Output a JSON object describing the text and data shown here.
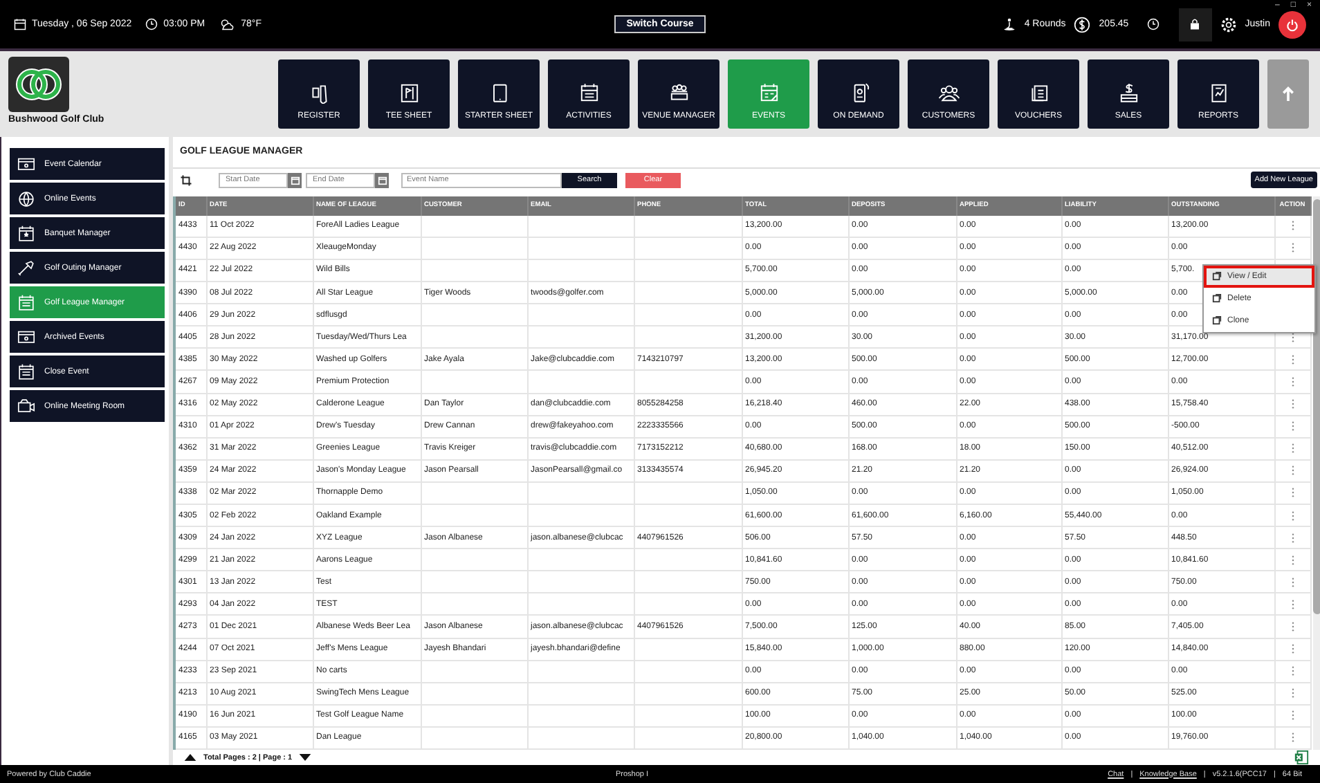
{
  "window_controls": [
    "–",
    "□",
    "×"
  ],
  "top_bar": {
    "date": "Tuesday , 06 Sep 2022",
    "time": "03:00 PM",
    "weather": "78°F",
    "switch_course": "Switch Course",
    "rounds": "4 Rounds",
    "balance": "205.45",
    "user": "Justin"
  },
  "club": {
    "name": "Bushwood Golf Club"
  },
  "nav": [
    {
      "label": "REGISTER",
      "selected": false
    },
    {
      "label": "TEE SHEET",
      "selected": false
    },
    {
      "label": "STARTER SHEET",
      "selected": false
    },
    {
      "label": "ACTIVITIES",
      "selected": false
    },
    {
      "label": "VENUE MANAGER",
      "selected": false
    },
    {
      "label": "EVENTS",
      "selected": true
    },
    {
      "label": "ON DEMAND",
      "selected": false
    },
    {
      "label": "CUSTOMERS",
      "selected": false
    },
    {
      "label": "VOUCHERS",
      "selected": false
    },
    {
      "label": "SALES",
      "selected": false
    },
    {
      "label": "REPORTS",
      "selected": false
    }
  ],
  "sidebar": [
    {
      "label": "Event Calendar",
      "selected": false
    },
    {
      "label": "Online Events",
      "selected": false
    },
    {
      "label": "Banquet Manager",
      "selected": false
    },
    {
      "label": "Golf Outing Manager",
      "selected": false
    },
    {
      "label": "Golf League Manager",
      "selected": true
    },
    {
      "label": "Archived Events",
      "selected": false
    },
    {
      "label": "Close Event",
      "selected": false
    },
    {
      "label": "Online Meeting Room",
      "selected": false
    }
  ],
  "page_title": "GOLF LEAGUE MANAGER",
  "filters": {
    "start_date": {
      "placeholder": "Start Date"
    },
    "end_date": {
      "placeholder": "End Date"
    },
    "event_name": {
      "placeholder": "Event Name"
    },
    "search": "Search",
    "clear": "Clear",
    "add": "Add New League"
  },
  "table": {
    "columns": [
      "ID",
      "DATE",
      "NAME OF LEAGUE",
      "CUSTOMER",
      "EMAIL",
      "PHONE",
      "TOTAL",
      "DEPOSITS",
      "APPLIED",
      "LIABILITY",
      "OUTSTANDING",
      "ACTION"
    ],
    "rows": [
      [
        "4433",
        "11 Oct 2022",
        "ForeAll Ladies League",
        null,
        null,
        null,
        "13,200.00",
        "0.00",
        "0.00",
        "0.00",
        "13,200.00"
      ],
      [
        "4430",
        "22 Aug 2022",
        "XleaugeMonday",
        null,
        null,
        null,
        "0.00",
        "0.00",
        "0.00",
        "0.00",
        "0.00"
      ],
      [
        "4421",
        "22 Jul 2022",
        "Wild Bills",
        null,
        null,
        null,
        "5,700.00",
        "0.00",
        "0.00",
        "0.00",
        "5,700."
      ],
      [
        "4390",
        "08 Jul 2022",
        "All Star League",
        "Tiger Woods",
        "twoods@golfer.com",
        null,
        "5,000.00",
        "5,000.00",
        "0.00",
        "5,000.00",
        "0.00"
      ],
      [
        "4406",
        "29 Jun 2022",
        "sdflusgd",
        null,
        null,
        null,
        "0.00",
        "0.00",
        "0.00",
        "0.00",
        "0.00"
      ],
      [
        "4405",
        "28 Jun 2022",
        "Tuesday/Wed/Thurs Lea",
        null,
        null,
        null,
        "31,200.00",
        "30.00",
        "0.00",
        "30.00",
        "31,170.00"
      ],
      [
        "4385",
        "30 May 2022",
        "Washed up Golfers",
        "Jake Ayala",
        "Jake@clubcaddie.com",
        "7143210797",
        "13,200.00",
        "500.00",
        "0.00",
        "500.00",
        "12,700.00"
      ],
      [
        "4267",
        "09 May 2022",
        "Premium Protection",
        null,
        null,
        null,
        "0.00",
        "0.00",
        "0.00",
        "0.00",
        "0.00"
      ],
      [
        "4316",
        "02 May 2022",
        "Calderone League",
        "Dan Taylor",
        "dan@clubcaddie.com",
        "8055284258",
        "16,218.40",
        "460.00",
        "22.00",
        "438.00",
        "15,758.40"
      ],
      [
        "4310",
        "01 Apr 2022",
        "Drew's Tuesday",
        "Drew Cannan",
        "drew@fakeyahoo.com",
        "2223335566",
        "0.00",
        "500.00",
        "0.00",
        "500.00",
        "-500.00"
      ],
      [
        "4362",
        "31 Mar 2022",
        "Greenies League",
        "Travis Kreiger",
        "travis@clubcaddie.com",
        "7173152212",
        "40,680.00",
        "168.00",
        "18.00",
        "150.00",
        "40,512.00"
      ],
      [
        "4359",
        "24 Mar 2022",
        "Jason's Monday League",
        "Jason Pearsall",
        "JasonPearsall@gmail.co",
        "3133435574",
        "26,945.20",
        "21.20",
        "21.20",
        "0.00",
        "26,924.00"
      ],
      [
        "4338",
        "02 Mar 2022",
        "Thornapple Demo",
        null,
        null,
        null,
        "1,050.00",
        "0.00",
        "0.00",
        "0.00",
        "1,050.00"
      ],
      [
        "4305",
        "02 Feb 2022",
        "Oakland Example",
        null,
        null,
        null,
        "61,600.00",
        "61,600.00",
        "6,160.00",
        "55,440.00",
        "0.00"
      ],
      [
        "4309",
        "24 Jan 2022",
        "XYZ League",
        "Jason Albanese",
        "jason.albanese@clubcac",
        "4407961526",
        "506.00",
        "57.50",
        "0.00",
        "57.50",
        "448.50"
      ],
      [
        "4299",
        "21 Jan 2022",
        "Aarons League",
        null,
        null,
        null,
        "10,841.60",
        "0.00",
        "0.00",
        "0.00",
        "10,841.60"
      ],
      [
        "4301",
        "13 Jan 2022",
        "Test",
        null,
        null,
        null,
        "750.00",
        "0.00",
        "0.00",
        "0.00",
        "750.00"
      ],
      [
        "4293",
        "04 Jan 2022",
        "TEST",
        null,
        null,
        null,
        "0.00",
        "0.00",
        "0.00",
        "0.00",
        "0.00"
      ],
      [
        "4273",
        "01 Dec 2021",
        "Albanese Weds Beer Lea",
        "Jason Albanese",
        "jason.albanese@clubcac",
        "4407961526",
        "7,500.00",
        "125.00",
        "40.00",
        "85.00",
        "7,405.00"
      ],
      [
        "4244",
        "07 Oct 2021",
        "Jeff's Mens League",
        "Jayesh Bhandari",
        "jayesh.bhandari@define",
        null,
        "15,840.00",
        "1,000.00",
        "880.00",
        "120.00",
        "14,840.00"
      ],
      [
        "4233",
        "23 Sep 2021",
        "No carts",
        null,
        null,
        null,
        "0.00",
        "0.00",
        "0.00",
        "0.00",
        "0.00"
      ],
      [
        "4213",
        "10 Aug 2021",
        "SwingTech Mens League",
        null,
        null,
        null,
        "600.00",
        "75.00",
        "25.00",
        "50.00",
        "525.00"
      ],
      [
        "4190",
        "16 Jun 2021",
        "Test Golf League Name",
        null,
        null,
        null,
        "100.00",
        "0.00",
        "0.00",
        "0.00",
        "100.00"
      ],
      [
        "4165",
        "03 May 2021",
        "Dan League",
        null,
        null,
        null,
        "20,800.00",
        "1,040.00",
        "1,040.00",
        "0.00",
        "19,760.00"
      ]
    ]
  },
  "context_menu": {
    "items": [
      {
        "label": "View / Edit",
        "selected": true
      },
      {
        "label": "Delete",
        "selected": false
      },
      {
        "label": "Clone",
        "selected": false
      }
    ]
  },
  "pagination": "Total Pages : 2 | Page : 1",
  "footer": {
    "powered_by": "Powered by Club Caddie",
    "station": "Proshop I",
    "items": [
      {
        "kind": "link",
        "text": "Chat"
      },
      {
        "kind": "sep",
        "text": "|"
      },
      {
        "kind": "link",
        "text": "Knowledge Base"
      },
      {
        "kind": "sep",
        "text": "|"
      },
      {
        "kind": "text",
        "text": "v5.2.1.6(PCC17"
      },
      {
        "kind": "sep",
        "text": "|"
      },
      {
        "kind": "text",
        "text": "64 Bit"
      }
    ]
  }
}
